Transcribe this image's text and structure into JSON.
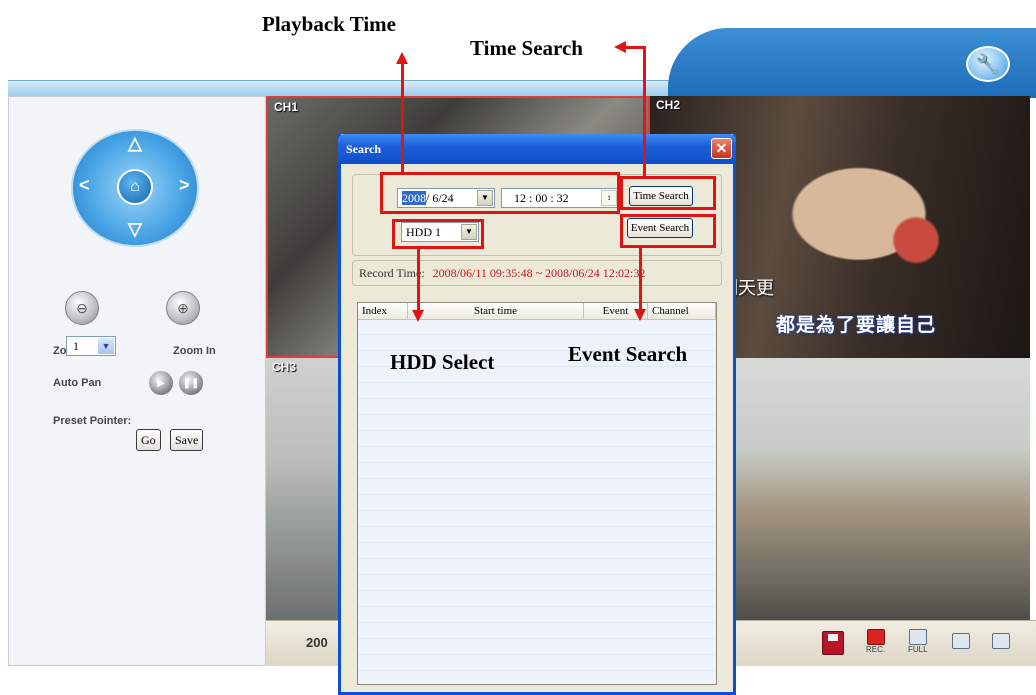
{
  "annotations": {
    "playback_time": "Playback Time",
    "time_search": "Time Search",
    "hdd_select": "HDD Select",
    "event_search": "Event Search"
  },
  "left_panel": {
    "zoom_out": "Zoom Out",
    "zoom_in": "Zoom In",
    "auto_pan": "Auto Pan",
    "preset_pointer": "Preset Pointer:",
    "preset_value": "1",
    "go_button": "Go",
    "save_button": "Save"
  },
  "channels": {
    "ch1": "CH1",
    "ch2": "CH2",
    "ch3": "CH3",
    "ch2_subtitle_line1": "明天更",
    "ch2_subtitle_line2": "都是為了要讓自己"
  },
  "bottom_bar": {
    "date_text": "200",
    "rec_label": "REC.",
    "full_label": "FULL"
  },
  "dialog": {
    "title": "Search",
    "close": "✕",
    "date_year_selected": "2008",
    "date_rest": "/ 6/24",
    "time_value": "12 : 00 : 32",
    "time_search_button": "Time Search",
    "hdd_value": "HDD 1",
    "event_search_button": "Event Search",
    "record_time_label": "Record Time:",
    "record_time_value": "2008/06/11 09:35:48 ~ 2008/06/24 12:02:32",
    "columns": [
      "Index",
      "Start time",
      "Event",
      "Channel"
    ]
  },
  "colors": {
    "annotation_red": "#e01414",
    "titlebar_blue": "#0f4ec9",
    "record_time_red": "#c21a1a"
  },
  "icons": [
    "wrench-icon",
    "home-icon",
    "zoom-out-icon",
    "zoom-in-icon",
    "play-icon",
    "pause-icon",
    "disk-icon",
    "rec-icon",
    "full-icon",
    "quad-icon",
    "single-icon"
  ]
}
